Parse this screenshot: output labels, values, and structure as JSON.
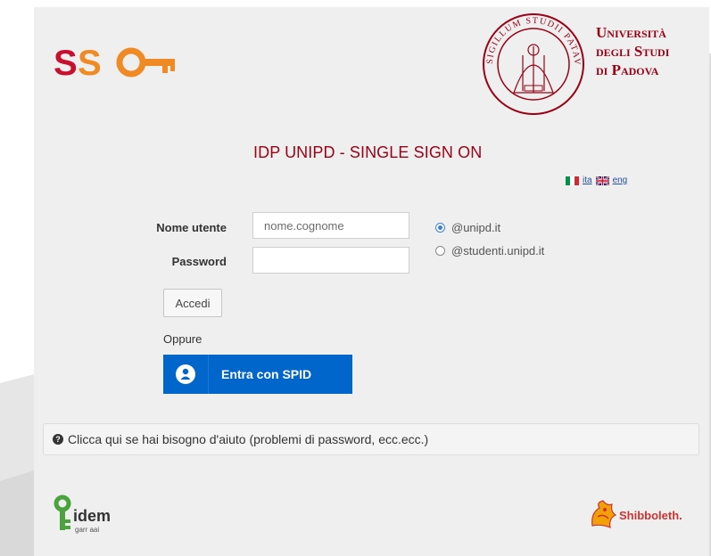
{
  "header": {
    "logo_text": "SSO",
    "university_lines": [
      "Università",
      "degli Studi",
      "di Padova"
    ],
    "seal_text": "SIGILLUM STUDII PATAVINI"
  },
  "page_title": "IDP UNIPD - SINGLE SIGN ON",
  "language": {
    "ita": "ita",
    "eng": "eng"
  },
  "form": {
    "username_label": "Nome utente",
    "username_placeholder": "nome.cognome",
    "password_label": "Password",
    "domain_options": [
      {
        "label": "@unipd.it",
        "selected": true
      },
      {
        "label": "@studenti.unipd.it",
        "selected": false
      }
    ],
    "submit_label": "Accedi",
    "or_label": "Oppure",
    "spid_label": "Entra con SPID"
  },
  "help": {
    "text": "Clicca qui se hai bisogno d'aiuto (problemi di password, ecc.ecc.)"
  },
  "footer": {
    "idem_text": "idem",
    "idem_sub": "garr aai",
    "shibboleth_text": "Shibboleth."
  },
  "colors": {
    "brand_red": "#9b0014",
    "spid_blue": "#0066cc",
    "panel_bg": "#efefef"
  }
}
